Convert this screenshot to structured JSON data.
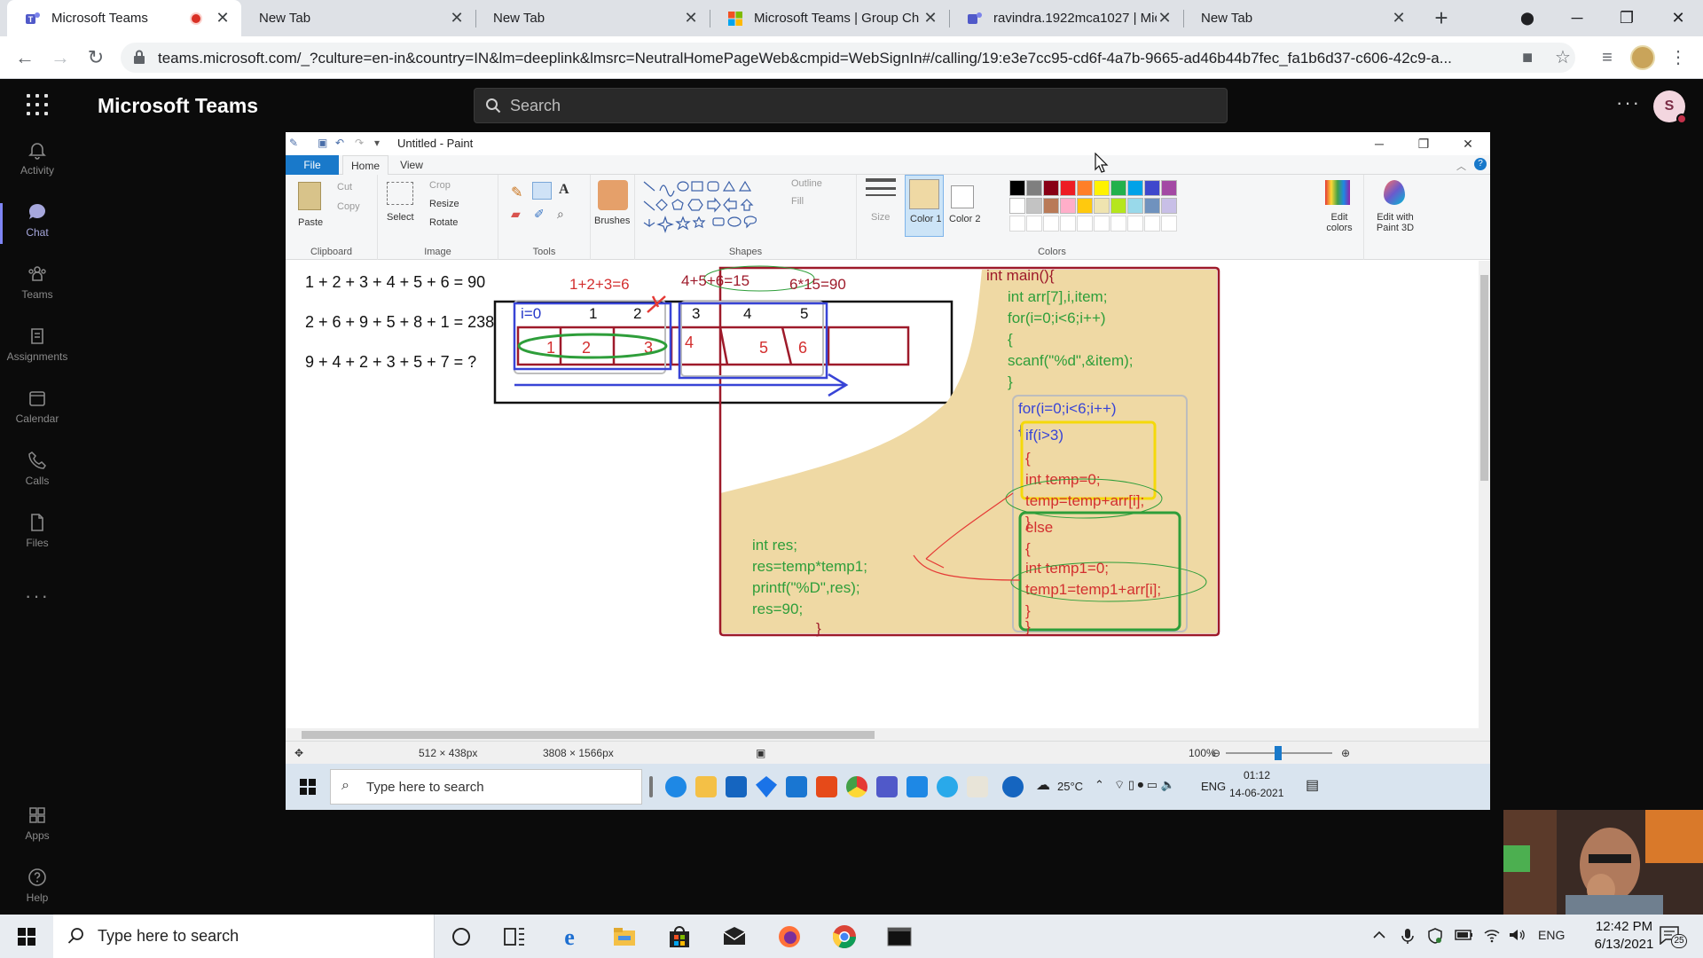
{
  "browser": {
    "tabs": [
      {
        "title": "Microsoft Teams",
        "active": true,
        "recording": true
      },
      {
        "title": "New Tab"
      },
      {
        "title": "New Tab"
      },
      {
        "title": "Microsoft Teams | Group Ch"
      },
      {
        "title": "ravindra.1922mca1027 | Mic"
      },
      {
        "title": "New Tab"
      }
    ],
    "url": "teams.microsoft.com/_?culture=en-in&country=IN&lm=deeplink&lmsrc=NeutralHomePageWeb&cmpid=WebSignIn#/calling/19:e3e7cc95-cd6f-4a7b-9665-ad46b44b7fec_fa1b6d37-c606-42c9-a..."
  },
  "teams": {
    "title": "Microsoft Teams",
    "search_placeholder": "Search",
    "avatar_initial": "S",
    "rail": [
      {
        "label": "Activity",
        "icon": "bell-icon"
      },
      {
        "label": "Chat",
        "icon": "chat-icon",
        "active": true
      },
      {
        "label": "Teams",
        "icon": "teams-icon"
      },
      {
        "label": "Assignments",
        "icon": "assignments-icon"
      },
      {
        "label": "Calendar",
        "icon": "calendar-icon"
      },
      {
        "label": "Calls",
        "icon": "phone-icon"
      },
      {
        "label": "Files",
        "icon": "file-icon"
      }
    ],
    "rail_bottom": [
      {
        "label": "Apps",
        "icon": "apps-icon"
      },
      {
        "label": "Help",
        "icon": "help-icon"
      }
    ]
  },
  "paint": {
    "title": "Untitled - Paint",
    "tabs": {
      "file": "File",
      "home": "Home",
      "view": "View"
    },
    "ribbon": {
      "paste": "Paste",
      "cut": "Cut",
      "copy": "Copy",
      "clipboard": "Clipboard",
      "select": "Select",
      "crop": "Crop",
      "resize": "Resize",
      "rotate": "Rotate",
      "image": "Image",
      "tools": "Tools",
      "brushes": "Brushes",
      "outline": "Outline",
      "fill": "Fill",
      "shapes": "Shapes",
      "size": "Size",
      "color1": "Color 1",
      "color2": "Color 2",
      "colors": "Colors",
      "edit_colors": "Edit colors",
      "edit_paint3d": "Edit with Paint 3D"
    },
    "palette": [
      "#000000",
      "#7f7f7f",
      "#880015",
      "#ed1c24",
      "#ff7f27",
      "#fff200",
      "#22b14c",
      "#00a2e8",
      "#3f48cc",
      "#a349a4",
      "#ffffff",
      "#c3c3c3",
      "#b97a57",
      "#ffaec9",
      "#ffc90e",
      "#efe4b0",
      "#b5e61d",
      "#99d9ea",
      "#7092be",
      "#c8bfe7"
    ],
    "color1": "#efd9a4",
    "color2": "#ffffff",
    "status": {
      "selection": "512 × 438px",
      "canvas": "3808 × 1566px",
      "zoom": "100%"
    },
    "canvas": {
      "sums": [
        "1 + 2 + 3 + 4 + 5 + 6 = 90",
        "2 + 6 + 9 + 5 + 8 + 1 = 238",
        "9 + 4 + 2 + 3 + 5 + 7 = ?"
      ],
      "calc1": "1+2+3=6",
      "calc2": "4+5+6=15",
      "calc3": "6*15=90",
      "index_labels": [
        "i=0",
        "1",
        "2",
        "3",
        "4",
        "5"
      ],
      "cell_values": [
        "1",
        "2",
        "3",
        "4",
        "5",
        "6"
      ],
      "code_main": [
        "int main(){",
        "int arr[7],i,item;",
        "for(i=0;i<6;i++)",
        "{",
        "scanf(\"%d\",&item);",
        "}"
      ],
      "code_loop": [
        "for(i=0;i<6;i++)",
        "{",
        "if(i>3)",
        "{",
        "int temp=0;",
        "temp=temp+arr[i];",
        "}"
      ],
      "code_else": [
        "else",
        "{",
        "int temp1=0;",
        "temp1=temp1+arr[i];",
        "}",
        "}"
      ],
      "code_res": [
        "int res;",
        "res=temp*temp1;",
        "printf(\"%D\",res);",
        "res=90;",
        "}"
      ]
    },
    "inner_taskbar": {
      "search_placeholder": "Type here to search",
      "weather": "25°C",
      "lang": "ENG",
      "time": "01:12",
      "date": "14-06-2021"
    }
  },
  "taskbar": {
    "search_placeholder": "Type here to search",
    "lang": "ENG",
    "time": "12:42 PM",
    "date": "6/13/2021",
    "notifications": "25"
  }
}
